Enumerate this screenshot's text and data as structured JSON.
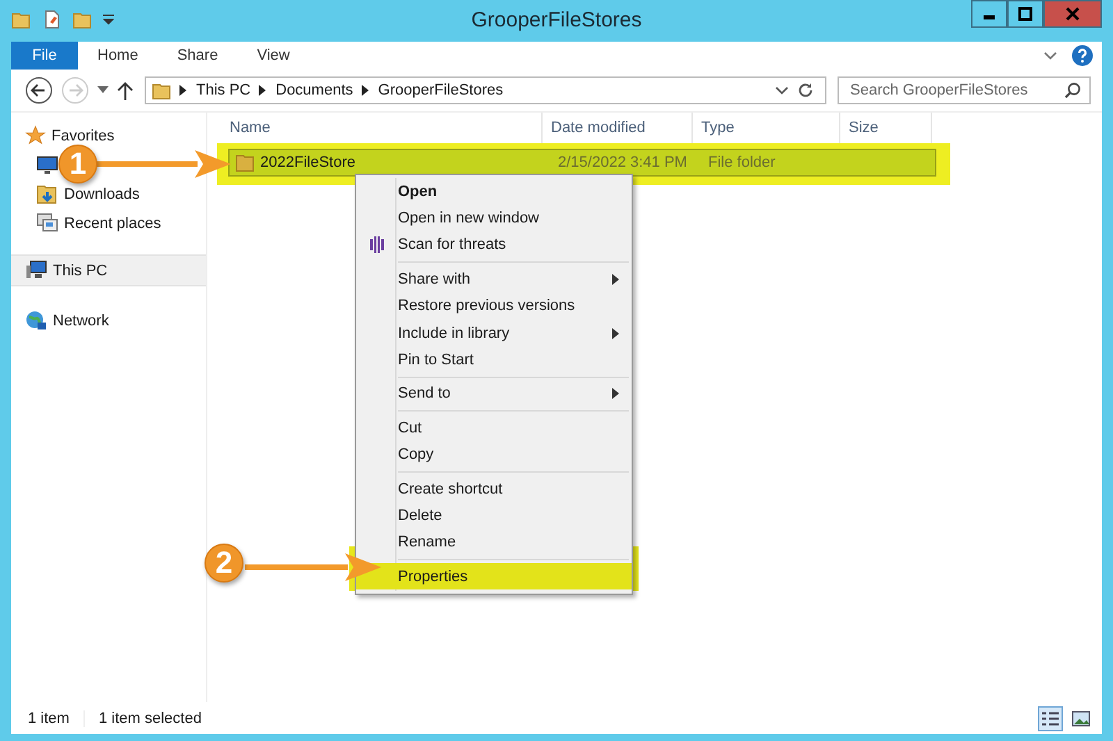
{
  "window": {
    "title": "GrooperFileStores"
  },
  "ribbon": {
    "tabs": [
      {
        "label": "File",
        "kind": "file",
        "selected": false
      },
      {
        "label": "Home",
        "kind": "tab",
        "selected": false
      },
      {
        "label": "Share",
        "kind": "tab",
        "selected": false
      },
      {
        "label": "View",
        "kind": "tab",
        "selected": false
      }
    ]
  },
  "address": {
    "crumbs": [
      "This PC",
      "Documents",
      "GrooperFileStores"
    ]
  },
  "search": {
    "placeholder": "Search GrooperFileStores"
  },
  "sidebar": {
    "items": [
      {
        "label": "Favorites",
        "kind": "star",
        "selected": false,
        "children": [
          {
            "kind": "desktop",
            "selected": false
          },
          {
            "label": "Downloads",
            "kind": "downloads",
            "selected": false
          },
          {
            "label": "Recent places",
            "kind": "recent",
            "selected": false
          }
        ]
      },
      {
        "label": "This PC",
        "kind": "pc",
        "selected": true
      },
      {
        "label": "Network",
        "kind": "network",
        "selected": false
      }
    ]
  },
  "table": {
    "columns": [
      "Name",
      "Date modified",
      "Type",
      "Size"
    ],
    "rows": [
      {
        "name": "2022FileStore",
        "date": "2/15/2022 3:41 PM",
        "type": "File folder",
        "selected": true
      }
    ]
  },
  "context_menu": {
    "groups": [
      [
        {
          "label": "Open",
          "default": true,
          "submenu": false,
          "kind": "plain"
        },
        {
          "label": "Open in new window",
          "default": false,
          "submenu": false,
          "kind": "plain"
        },
        {
          "label": "Scan for threats",
          "default": false,
          "submenu": false,
          "kind": "scan"
        }
      ],
      [
        {
          "label": "Share with",
          "default": false,
          "submenu": true,
          "kind": "plain"
        },
        {
          "label": "Restore previous versions",
          "default": false,
          "submenu": false,
          "kind": "plain"
        },
        {
          "label": "Include in library",
          "default": false,
          "submenu": true,
          "kind": "plain"
        },
        {
          "label": "Pin to Start",
          "default": false,
          "submenu": false,
          "kind": "plain"
        }
      ],
      [
        {
          "label": "Send to",
          "default": false,
          "submenu": true,
          "kind": "plain"
        }
      ],
      [
        {
          "label": "Cut",
          "default": false,
          "submenu": false,
          "kind": "plain"
        },
        {
          "label": "Copy",
          "default": false,
          "submenu": false,
          "kind": "plain"
        }
      ],
      [
        {
          "label": "Create shortcut",
          "default": false,
          "submenu": false,
          "kind": "plain"
        },
        {
          "label": "Delete",
          "default": false,
          "submenu": false,
          "kind": "plain"
        },
        {
          "label": "Rename",
          "default": false,
          "submenu": false,
          "kind": "plain"
        }
      ],
      [
        {
          "label": "Properties",
          "default": false,
          "submenu": false,
          "kind": "plain",
          "highlighted": true
        }
      ]
    ]
  },
  "callouts": [
    {
      "number": "1"
    },
    {
      "number": "2"
    }
  ],
  "status_bar": {
    "count": "1 item",
    "selection": "1 item selected"
  },
  "view_buttons": [
    {
      "kind": "details",
      "selected": true
    },
    {
      "kind": "thumbnails",
      "selected": false
    }
  ]
}
